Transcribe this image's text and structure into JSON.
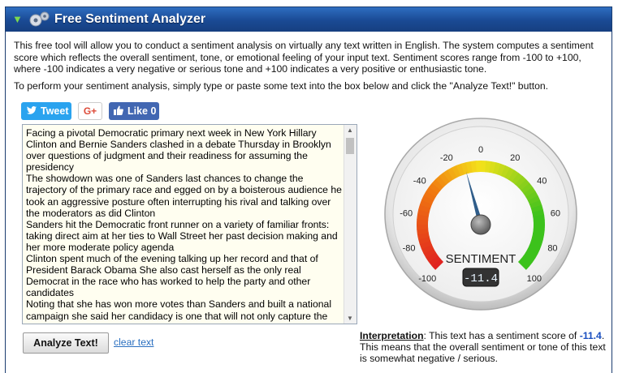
{
  "header": {
    "title": "Free Sentiment Analyzer"
  },
  "intro": {
    "p1": "This free tool will allow you to conduct a sentiment analysis on virtually any text written in English. The system computes a sentiment score which reflects the overall sentiment, tone, or emotional feeling of your input text. Sentiment scores range from -100 to +100, where -100 indicates a very negative or serious tone and +100 indicates a very positive or enthusiastic tone.",
    "p2": "To perform your sentiment analysis, simply type or paste some text into the box below and click the \"Analyze Text!\" button."
  },
  "share": {
    "tweet": "Tweet",
    "gplus": "G+",
    "like": "Like 0"
  },
  "input": {
    "text": "Facing a pivotal Democratic primary next week in New York Hillary Clinton and Bernie Sanders clashed in a debate Thursday in Brooklyn over questions of judgment and their readiness for assuming the presidency\nThe showdown was one of Sanders last chances to change the trajectory of the primary race and egged on by a boisterous audience he took an aggressive posture often interrupting his rival and talking over the moderators as did Clinton\nSanders hit the Democratic front runner on a variety of familiar fronts: taking direct aim at her ties to Wall Street her past decision making and her more moderate policy agenda\nClinton spent much of the evening talking up her record and that of President Barack Obama She also cast herself as the only real Democrat in the race who has worked to help the party and other candidates\nNoting that she has won more votes than Sanders and built a national campaign she said her candidacy is one that will not only capture the Democratic nomination but a campaign that will defeat whoever the"
  },
  "actions": {
    "analyze": "Analyze Text!",
    "clear": "clear text"
  },
  "interpretation": {
    "heading": "Interpretation",
    "pre": ": This text has a sentiment score of ",
    "score": "-11.4",
    "post": ". This means that the overall sentiment or tone of this text is somewhat negative / serious."
  },
  "gauge": {
    "label": "SENTIMENT",
    "readout": "-11.4",
    "value": -11.4,
    "min": -100,
    "max": 100,
    "ticks": [
      "-100",
      "-80",
      "-60",
      "-40",
      "-20",
      "0",
      "20",
      "40",
      "60",
      "80",
      "100"
    ],
    "colors": {
      "red": "#e02020",
      "orange": "#f07a10",
      "yellow": "#f4e21a",
      "green": "#3cc21c",
      "needle": "#2f5d8a"
    }
  }
}
